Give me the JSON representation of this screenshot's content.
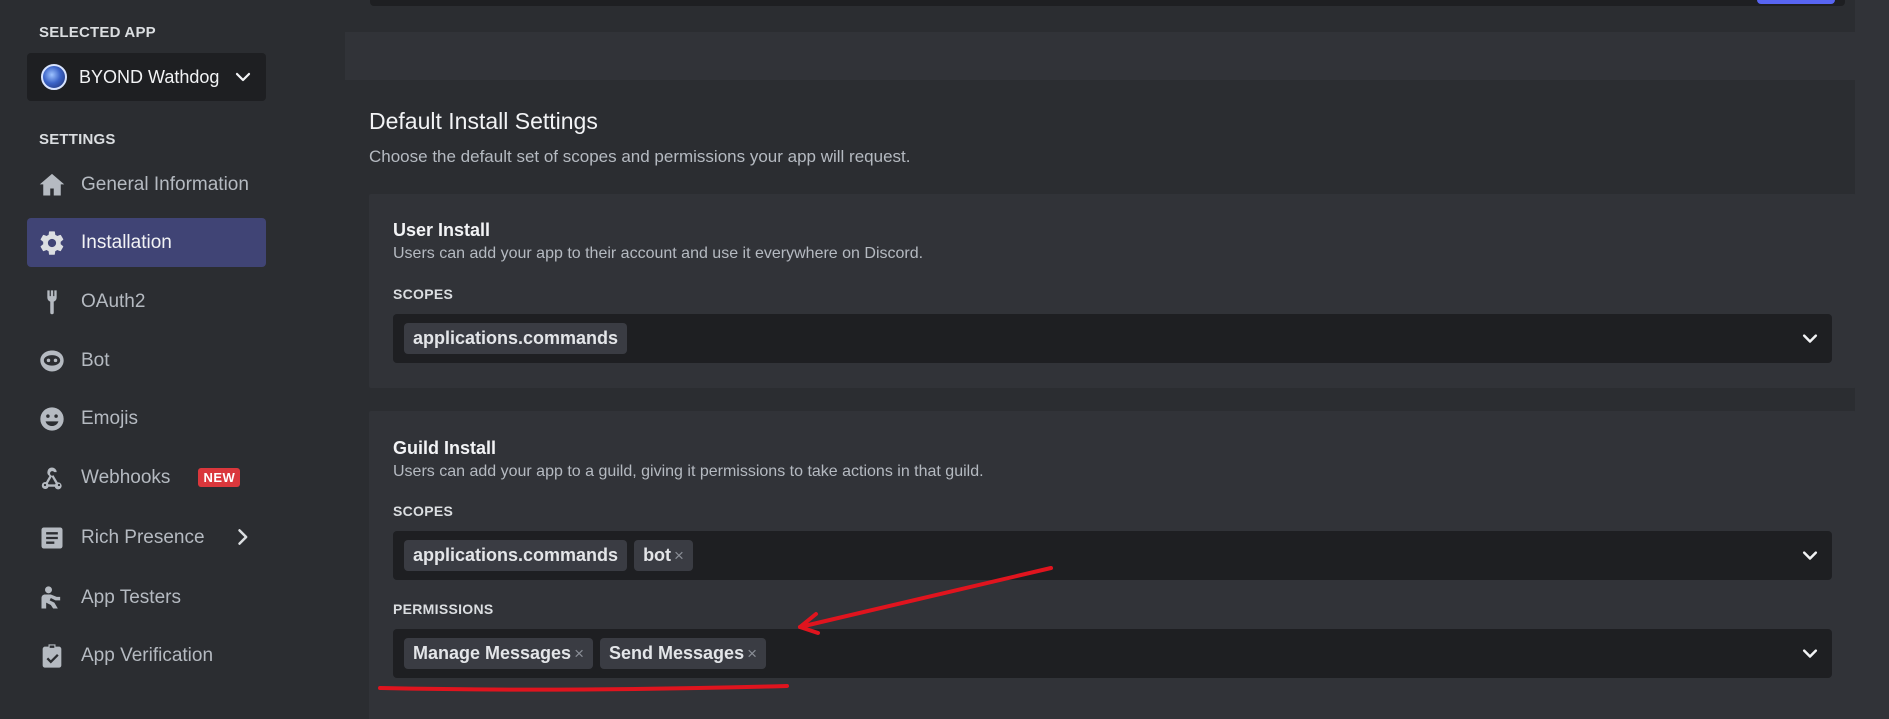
{
  "sidebar": {
    "selected_app_label": "SELECTED APP",
    "app_name": "BYOND Wathdog",
    "settings_label": "SETTINGS",
    "items": [
      {
        "label": "General Information",
        "icon": "home-icon"
      },
      {
        "label": "Installation",
        "icon": "gear-icon",
        "active": true
      },
      {
        "label": "OAuth2",
        "icon": "wrench-icon"
      },
      {
        "label": "Bot",
        "icon": "robot-icon"
      },
      {
        "label": "Emojis",
        "icon": "smile-icon"
      },
      {
        "label": "Webhooks",
        "icon": "webhook-icon",
        "badge": "NEW"
      },
      {
        "label": "Rich Presence",
        "icon": "document-icon"
      },
      {
        "label": "App Testers",
        "icon": "tester-icon"
      },
      {
        "label": "App Verification",
        "icon": "clipboard-check-icon"
      }
    ]
  },
  "main": {
    "title": "Default Install Settings",
    "description": "Choose the default set of scopes and permissions your app will request.",
    "user_install": {
      "title": "User Install",
      "description": "Users can add your app to their account and use it everywhere on Discord.",
      "scopes_label": "SCOPES",
      "scopes": [
        "applications.commands"
      ]
    },
    "guild_install": {
      "title": "Guild Install",
      "description": "Users can add your app to a guild, giving it permissions to take actions in that guild.",
      "scopes_label": "SCOPES",
      "scopes": [
        "applications.commands",
        "bot"
      ],
      "permissions_label": "PERMISSIONS",
      "permissions": [
        "Manage Messages",
        "Send Messages"
      ]
    }
  },
  "colors": {
    "background": "#313338",
    "sidebar": "#2b2d31",
    "active_nav": "#404475",
    "annotation": "#e0141e",
    "badge": "#da373c"
  }
}
